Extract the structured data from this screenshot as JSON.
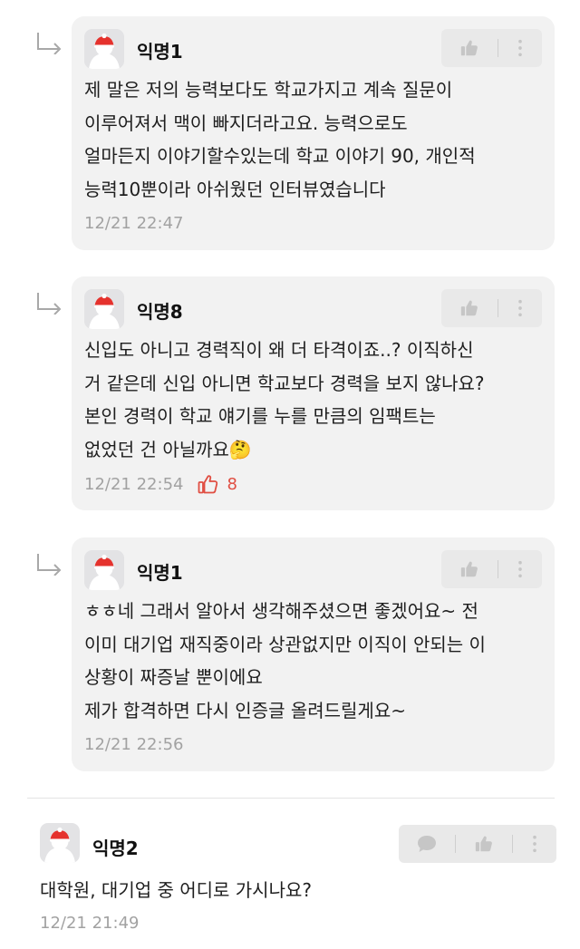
{
  "comments": [
    {
      "author": "익명1",
      "lines": [
        "제 말은 저의 능력보다도 학교가지고 계속 질문이",
        "이루어져서 맥이 빠지더라고요. 능력으로도",
        "얼마든지 이야기할수있는데 학교 이야기 90, 개인적",
        "능력10뿐이라 아쉬웠던 인터뷰였습니다"
      ],
      "time": "12/21 22:47"
    },
    {
      "author": "익명8",
      "lines": [
        "신입도 아니고 경력직이 왜 더 타격이죠..? 이직하신",
        "거 같은데 신입 아니면 학교보다 경력을 보지 않나요?",
        "본인 경력이 학교 얘기를 누를 만큼의 임팩트는",
        "없었던 건 아닐까요🤔"
      ],
      "time": "12/21 22:54",
      "likes": "8"
    },
    {
      "author": "익명1",
      "lines": [
        "ㅎㅎ네 그래서 알아서 생각해주셨으면 좋겠어요~ 전",
        "이미 대기업 재직중이라 상관없지만 이직이 안되는 이",
        "상황이 짜증날 뿐이에요",
        "제가 합격하면 다시 인증글 올려드릴게요~"
      ],
      "time": "12/21 22:56"
    }
  ],
  "top_comment": {
    "author": "익명2",
    "text": "대학원, 대기업 중 어디로 가시나요?",
    "time": "12/21 21:49"
  },
  "colors": {
    "card_bg": "#f2f2f2",
    "like_red": "#e04e42",
    "meta_gray": "#a2a2a2"
  },
  "icons": [
    "reply-arrow-icon",
    "thumbs-up-icon",
    "more-vertical-icon",
    "comment-bubble-icon",
    "avatar-icon"
  ]
}
